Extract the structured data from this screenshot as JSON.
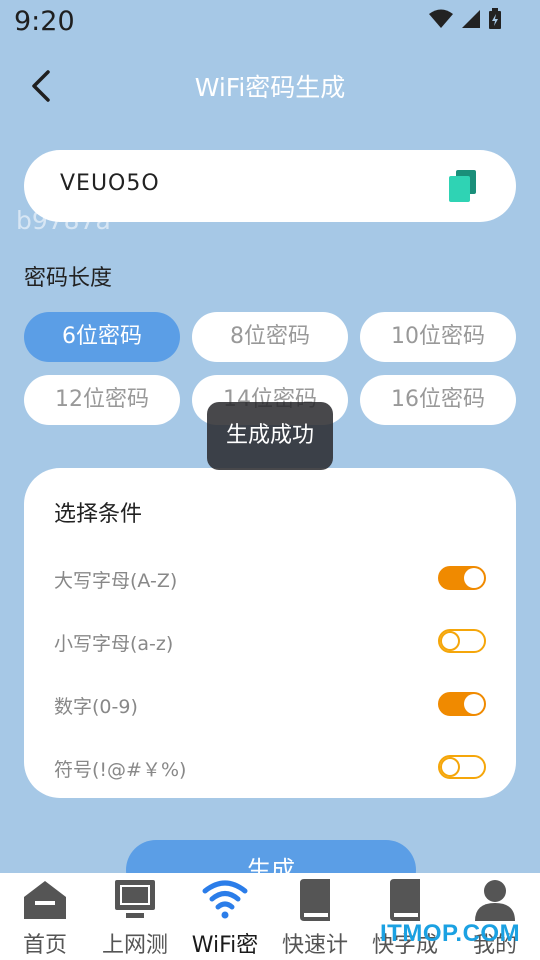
{
  "status": {
    "time": "9:20"
  },
  "header": {
    "title": "WiFi密码生成",
    "back_icon": "back-arrow-icon"
  },
  "password": {
    "value": "VEUO5O",
    "copy_icon": "copy-icon"
  },
  "watermark": "b9787a",
  "length_section": {
    "label": "密码长度",
    "options": [
      "6位密码",
      "8位密码",
      "10位密码",
      "12位密码",
      "14位密码",
      "16位密码"
    ],
    "selected": "6位密码"
  },
  "toast": "生成成功",
  "conditions": {
    "title": "选择条件",
    "items": [
      {
        "label": "大写字母(A-Z)",
        "on": true
      },
      {
        "label": "小写字母(a-z)",
        "on": false
      },
      {
        "label": "数字(0-9)",
        "on": true
      },
      {
        "label": "符号(!@#￥%)",
        "on": false
      }
    ]
  },
  "generate_label": "生成",
  "nav": {
    "items": [
      {
        "label": "首页",
        "icon": "home-icon"
      },
      {
        "label": "上网测",
        "icon": "monitor-icon"
      },
      {
        "label": "WiFi密",
        "icon": "wifi-icon"
      },
      {
        "label": "快速计",
        "icon": "book-icon"
      },
      {
        "label": "快字成",
        "icon": "book-icon"
      },
      {
        "label": "我的",
        "icon": "user-icon"
      }
    ],
    "active": "WiFi密"
  },
  "site_mark": "ITMOP.COM",
  "colors": {
    "background": "#a6c8e6",
    "accent": "#5b9ee6",
    "toggle_on": "#f08a00",
    "copy_icon": "#2fd3b4"
  }
}
